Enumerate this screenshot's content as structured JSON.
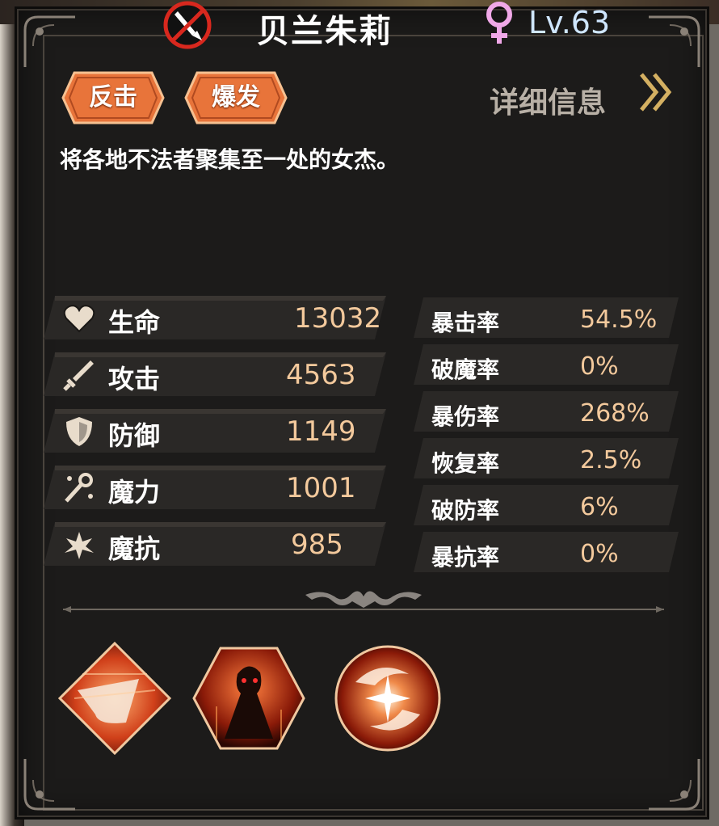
{
  "character": {
    "name": "贝兰朱莉",
    "level": "Lv.63",
    "class_icon": "sword-no-icon",
    "gender_icon": "female-symbol-icon",
    "tags": [
      "反击",
      "爆发"
    ],
    "detail_label": "详细信息",
    "description": "将各地不法者聚集至一处的女杰。"
  },
  "stats_left": [
    {
      "icon": "heart-icon",
      "label": "生命",
      "value": "13032"
    },
    {
      "icon": "sword-icon",
      "label": "攻击",
      "value": "4563"
    },
    {
      "icon": "shield-icon",
      "label": "防御",
      "value": "1149"
    },
    {
      "icon": "staff-icon",
      "label": "魔力",
      "value": "1001"
    },
    {
      "icon": "magic-resist-icon",
      "label": "魔抗",
      "value": "985"
    }
  ],
  "stats_right": [
    {
      "label": "暴击率",
      "value": "54.5%"
    },
    {
      "label": "破魔率",
      "value": "0%"
    },
    {
      "label": "暴伤率",
      "value": "268%"
    },
    {
      "label": "恢复率",
      "value": "2.5%"
    },
    {
      "label": "破防率",
      "value": "6%"
    },
    {
      "label": "暴抗率",
      "value": "0%"
    }
  ],
  "skills": [
    "slash-skill-icon",
    "berserk-skill-icon",
    "spin-skill-icon"
  ],
  "colors": {
    "panel": "#1c1b1a",
    "value": "#f3c99c",
    "level": "#cfe6ff",
    "tag_orange": "#e8743a",
    "gender_pink": "#f0a8e8"
  }
}
